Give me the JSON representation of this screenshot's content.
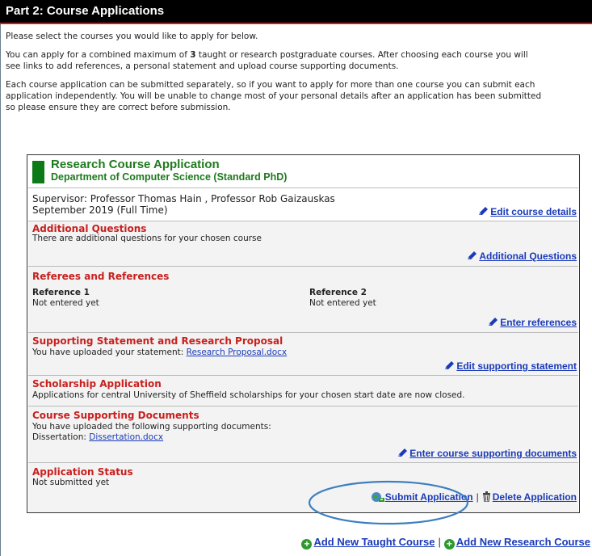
{
  "header": {
    "title": "Part 2: Course Applications"
  },
  "intro": {
    "line1": "Please select the courses you would like to apply for below.",
    "line2_pre": "You can apply for a combined maximum of ",
    "line2_max": "3",
    "line2_post": " taught or research postgraduate courses. After choosing each course you will",
    "line3": "see links to add references, a personal statement and upload course supporting documents.",
    "line4": "Each course application can be submitted separately, so if you want to apply for more than one course you can submit each",
    "line5": "application independently. You will be unable to change most of your personal details after an application has been submitted",
    "line6": "so please ensure they are correct before submission."
  },
  "application": {
    "title": "Research Course Application",
    "department": "Department of Computer Science (Standard PhD)",
    "supervisor": "Supervisor: Professor Thomas Hain , Professor Rob Gaizauskas",
    "start": "September 2019 (Full Time)",
    "edit_course_label": "Edit course details",
    "additional": {
      "title": "Additional Questions",
      "text": "There are additional questions for your chosen course",
      "action": "Additional Questions"
    },
    "referees": {
      "title": "Referees and References",
      "ref1_label": "Reference 1",
      "ref1_status": "Not entered yet",
      "ref2_label": "Reference 2",
      "ref2_status": "Not entered yet",
      "action": "Enter references"
    },
    "statement": {
      "title": "Supporting Statement and Research Proposal",
      "text": "You have uploaded your statement: ",
      "file": "Research Proposal.docx",
      "action": "Edit supporting statement"
    },
    "scholarship": {
      "title": "Scholarship Application",
      "text": "Applications for central University of Sheffield scholarships for your chosen start date are now closed."
    },
    "documents": {
      "title": "Course Supporting Documents",
      "text": "You have uploaded the following supporting documents:",
      "item_label": "Dissertation: ",
      "item_file": "Dissertation.docx",
      "action": "Enter course supporting documents"
    },
    "status": {
      "title": "Application Status",
      "text": "Not submitted yet",
      "submit": "Submit Application",
      "separator": "|",
      "delete": "Delete Application"
    }
  },
  "footer": {
    "add_taught": "Add New Taught Course",
    "separator": "|",
    "add_research": "Add New Research Course"
  },
  "colors": {
    "header_bg": "#000000",
    "accent_red": "#c8201e",
    "link_blue": "#1a3ab8",
    "course_green": "#1e7a1e"
  }
}
